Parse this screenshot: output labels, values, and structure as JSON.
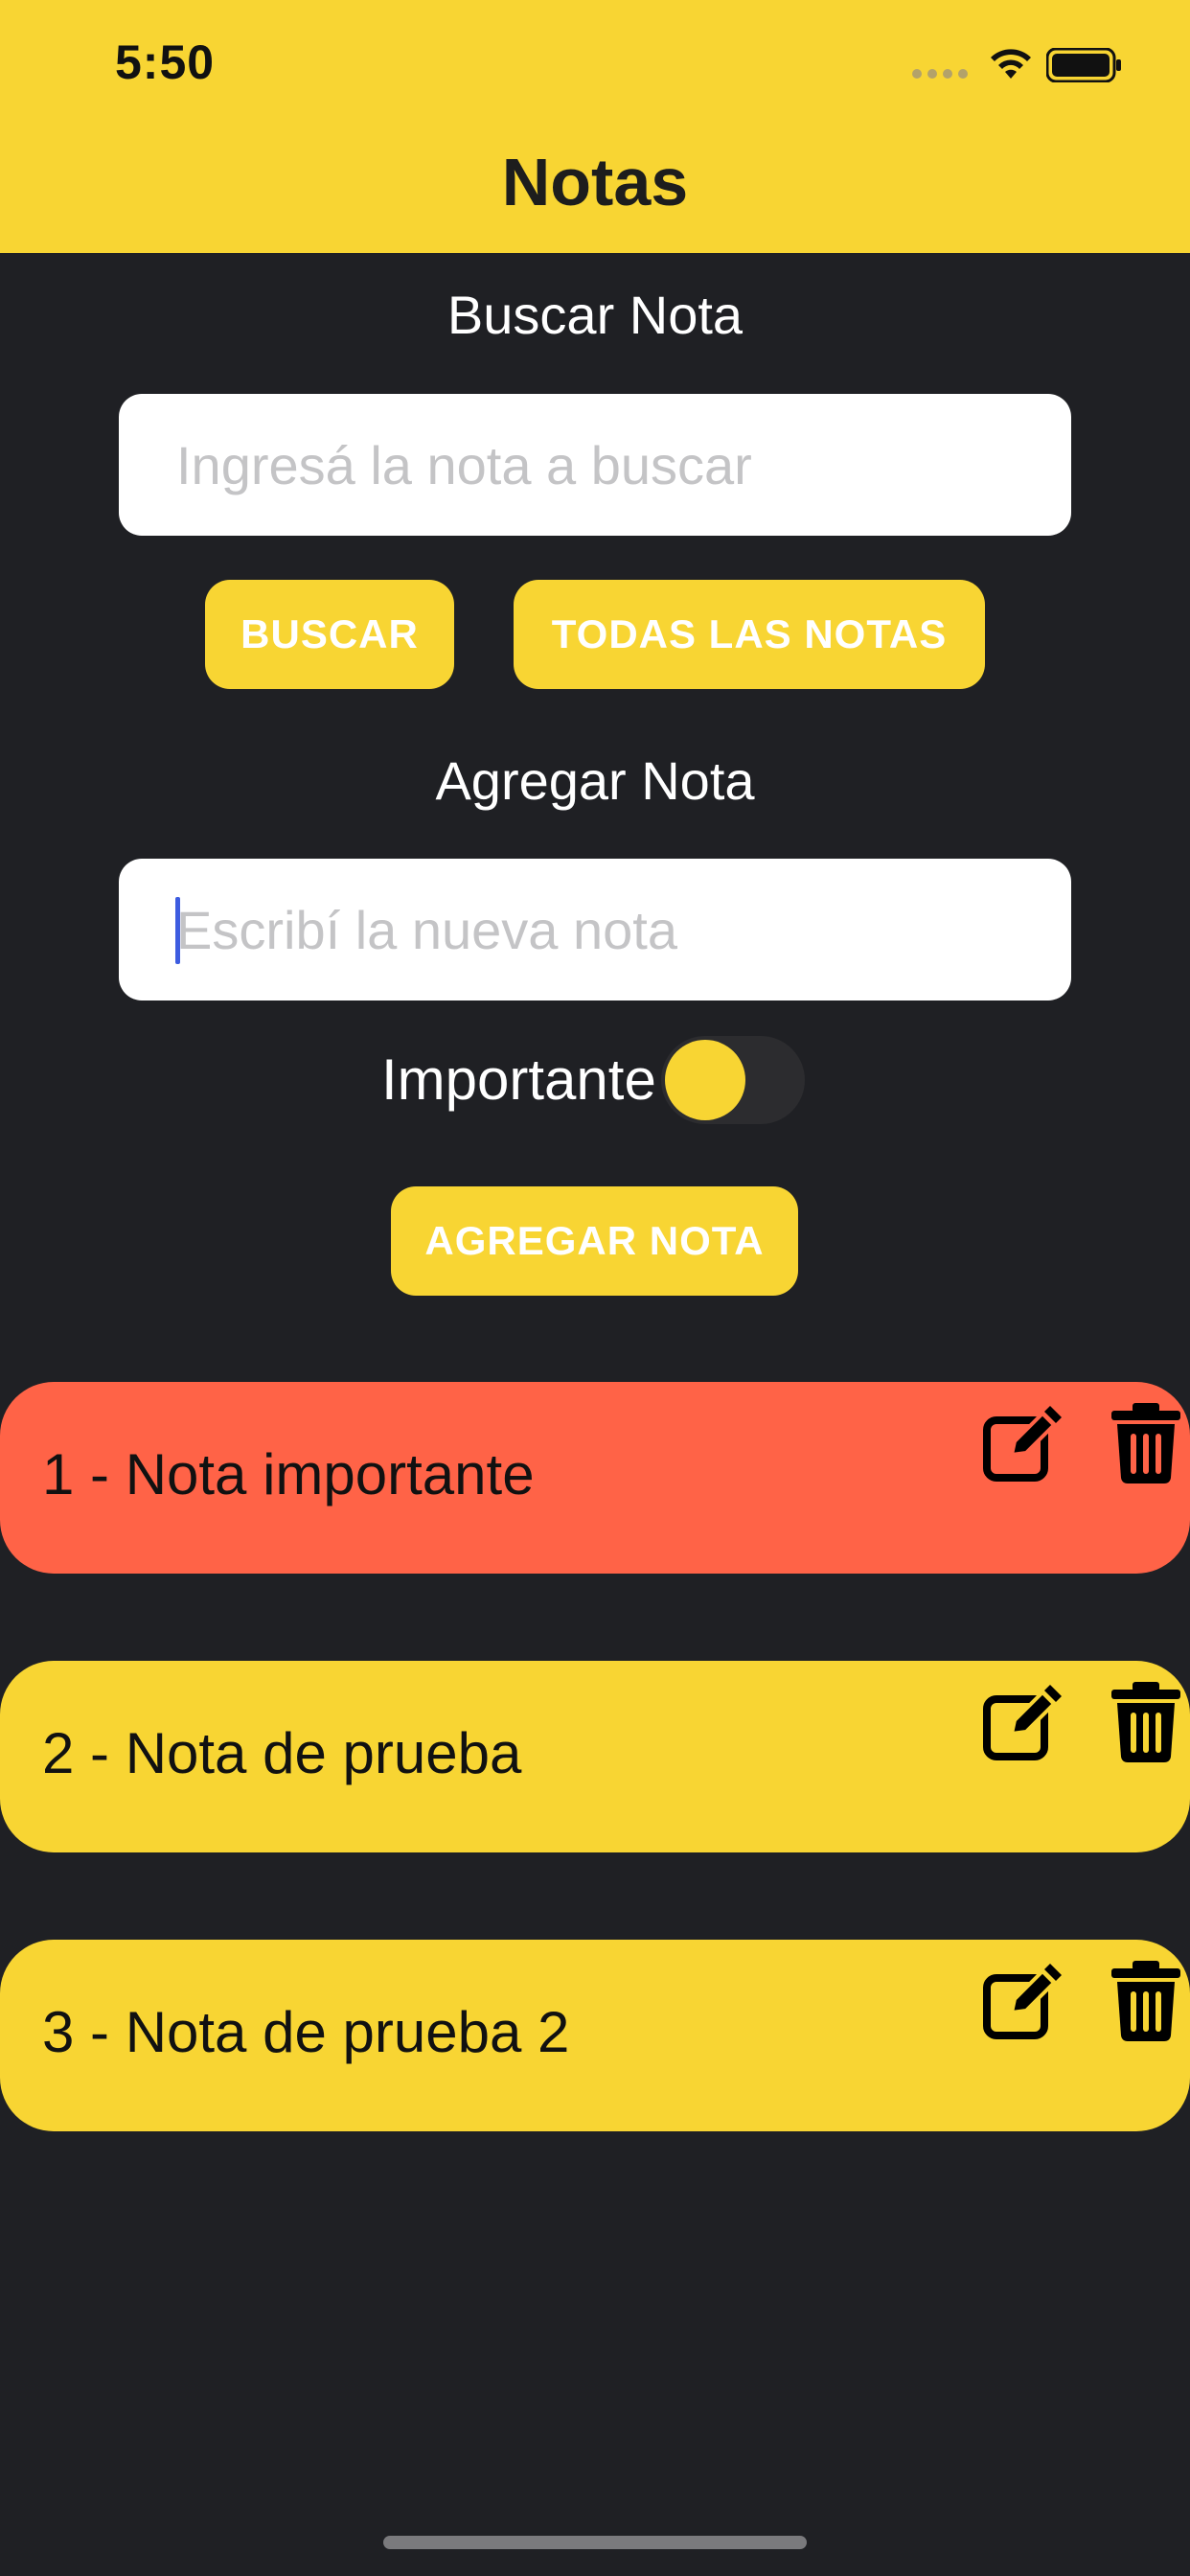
{
  "status_bar": {
    "time": "5:50",
    "icons": [
      "signal-icon",
      "wifi-icon",
      "battery-icon"
    ]
  },
  "nav": {
    "title": "Notas"
  },
  "search": {
    "label": "Buscar Nota",
    "placeholder": "Ingresá la nota a buscar",
    "search_button": "BUSCAR",
    "all_button": "TODAS LAS NOTAS"
  },
  "add": {
    "label": "Agregar Nota",
    "placeholder": "Escribí la nueva nota",
    "important_label": "Importante",
    "important_on": false,
    "add_button": "AGREGAR NOTA"
  },
  "notes": [
    {
      "text": "1 - Nota importante",
      "important": true
    },
    {
      "text": "2 - Nota de prueba",
      "important": false
    },
    {
      "text": "3 - Nota de prueba 2",
      "important": false
    }
  ],
  "colors": {
    "accent": "#f8d533",
    "background": "#1f2024",
    "important": "#ff6347"
  }
}
